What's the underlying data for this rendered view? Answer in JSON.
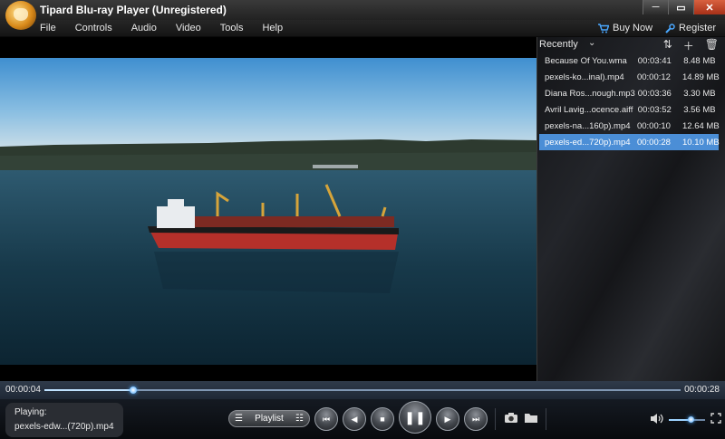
{
  "window": {
    "title": "Tipard Blu-ray Player (Unregistered)",
    "controls": {
      "minimize": "─",
      "maximize": "▭",
      "close": "✕"
    }
  },
  "menu": {
    "items": [
      "File",
      "Controls",
      "Audio",
      "Video",
      "Tools",
      "Help"
    ],
    "buy_now": "Buy Now",
    "register": "Register"
  },
  "playlist": {
    "sort_label": "Recently",
    "items": [
      {
        "name": "Because Of You.wma",
        "duration": "00:03:41",
        "size": "8.48 MB",
        "active": false
      },
      {
        "name": "pexels-ko...inal).mp4",
        "duration": "00:00:12",
        "size": "14.89 MB",
        "active": false
      },
      {
        "name": "Diana Ros...nough.mp3",
        "duration": "00:03:36",
        "size": "3.30 MB",
        "active": false
      },
      {
        "name": "Avril Lavig...ocence.aiff",
        "duration": "00:03:52",
        "size": "3.56 MB",
        "active": false
      },
      {
        "name": "pexels-na...160p).mp4",
        "duration": "00:00:10",
        "size": "12.64 MB",
        "active": false
      },
      {
        "name": "pexels-ed...720p).mp4",
        "duration": "00:00:28",
        "size": "10.10 MB",
        "active": true
      }
    ]
  },
  "playback": {
    "current_time": "00:00:04",
    "total_time": "00:00:28",
    "progress": 0.14,
    "volume": 0.6,
    "playing_label": "Playing:",
    "playing_file": "pexels-edw...(720p).mp4",
    "playlist_button": "Playlist"
  },
  "colors": {
    "accent": "#4b8ed6",
    "progress_glow": "#3fa3ff"
  },
  "icons": [
    "cart-icon",
    "wrench-icon",
    "chevron-down-icon",
    "sort-icon",
    "add-icon",
    "trash-icon",
    "playlist-list-icon",
    "playlist-mode-icon",
    "prev-chapter-icon",
    "rewind-icon",
    "stop-icon",
    "pause-icon",
    "fast-forward-icon",
    "next-chapter-icon",
    "snapshot-icon",
    "folder-icon",
    "volume-icon",
    "fullscreen-icon"
  ]
}
